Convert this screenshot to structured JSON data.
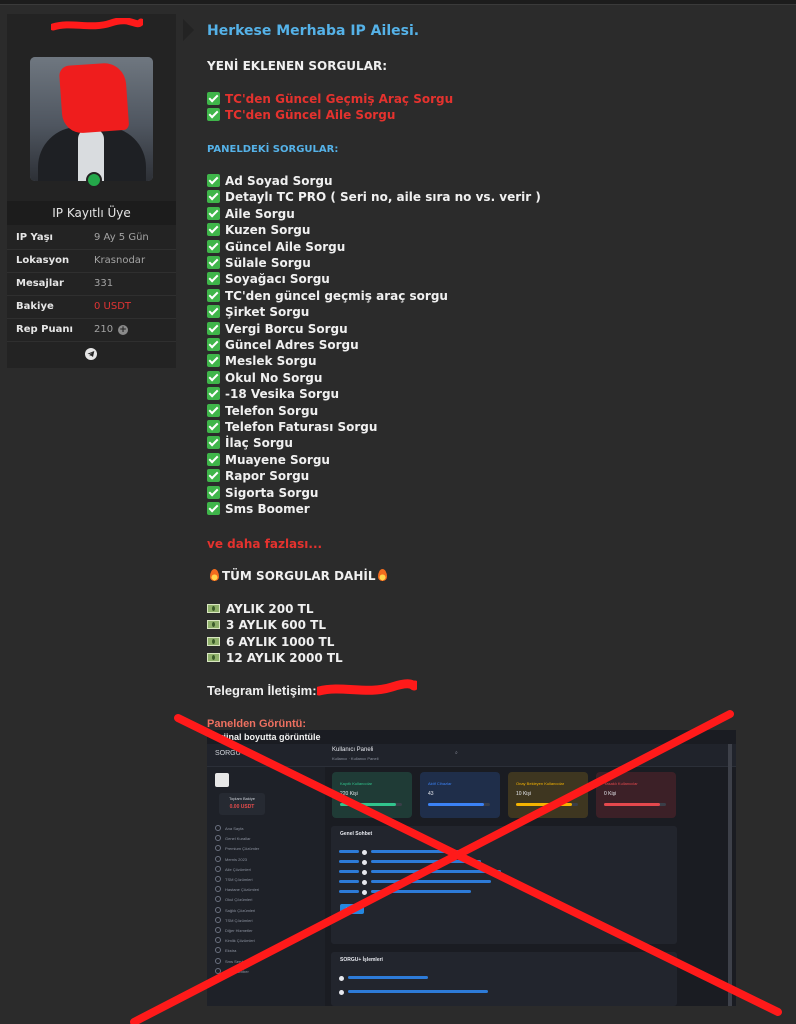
{
  "user": {
    "username": "",
    "rank": "IP Kayıtlı Üye",
    "stats": [
      {
        "label": "IP Yaşı",
        "value": "9 Ay 5 Gün",
        "highlight": false
      },
      {
        "label": "Lokasyon",
        "value": "Krasnodar",
        "highlight": false
      },
      {
        "label": "Mesajlar",
        "value": "331",
        "highlight": false
      },
      {
        "label": "Bakiye",
        "value": "0 USDT",
        "highlight": true
      },
      {
        "label": "Rep Puanı",
        "value": "210",
        "highlight": false
      }
    ],
    "online_color": "#24a84a"
  },
  "post": {
    "greeting": "Herkese Merhaba IP Ailesi.",
    "new_heading": "YENİ EKLENEN SORGULAR:",
    "new_items": [
      "TC'den Güncel Geçmiş Araç Sorgu",
      "TC'den Güncel Aile Sorgu"
    ],
    "panel_heading": "PANELDEKİ SORGULAR:",
    "panel_items": [
      "Ad Soyad Sorgu",
      "Detaylı TC PRO ( Seri no, aile sıra no vs. verir )",
      "Aile Sorgu",
      "Kuzen Sorgu",
      "Güncel Aile Sorgu",
      "Sülale Sorgu",
      "Soyağacı Sorgu",
      "TC'den güncel geçmiş araç sorgu",
      "Şirket Sorgu",
      "Vergi Borcu Sorgu",
      "Güncel Adres Sorgu",
      "Meslek Sorgu",
      "Okul No Sorgu",
      "-18 Vesika Sorgu",
      "Telefon Sorgu",
      "Telefon Faturası Sorgu",
      "İlaç Sorgu",
      "Muayene Sorgu",
      "Rapor Sorgu",
      "Sigorta Sorgu",
      "Sms Boomer"
    ],
    "more": "ve daha fazlası...",
    "all_included": "TÜM SORGULAR DAHİL",
    "prices": [
      "AYLIK 200 TL",
      "3 AYLIK 600 TL",
      "6 AYLIK 1000 TL",
      "12 AYLIK 2000 TL"
    ],
    "telegram": "Telegram İletişim:",
    "screenshot_label": "Panelden Görüntü:"
  },
  "screenshot": {
    "caption": "Orjinal boyutta görüntüle",
    "brand": "SORGU",
    "title": "Kullanıcı Paneli",
    "subtitle": "Kullanıcı  ·  Kullanıcı Paneli",
    "balance_label": "Toplam Bakiye",
    "balance_value": "0.00 USDT",
    "nav": [
      "Ana Sayfa",
      "Genel Kurallar",
      "Premium Çözümler",
      "Mernis 2023",
      "Aile Çözümleri",
      "TSM Çözümleri",
      "Hastane Çözümleri",
      "Okul Çözümleri",
      "Sağlık Çözümleri",
      "TSM Çözümleri",
      "Diğer Hizmetler",
      "Kimlik Çözümleri",
      "Ekstra",
      "Sms Servisi",
      "SMS Bomber"
    ],
    "cards": [
      {
        "title": "Kayıtlı Kullanıcılar",
        "value": "220 Kişi",
        "bg": "#1f3b36",
        "accent": "#31c48d",
        "level": 0.9
      },
      {
        "title": "Aktif Cihazlar",
        "value": "43",
        "bg": "#1f2e4a",
        "accent": "#3b82f6",
        "level": 0.9
      },
      {
        "title": "Onay Bekleyen Kullanıcılar",
        "value": "10 Kişi",
        "bg": "#3e3620",
        "accent": "#f5b301",
        "level": 0.9
      },
      {
        "title": "Yasaklı Kullanıcılar",
        "value": "0 Kişi",
        "bg": "#3c2027",
        "accent": "#e5484d",
        "level": 0.9
      }
    ],
    "chat_title": "Genel Sohbet",
    "chat_button": "Gönder",
    "log_title": "SORGU+ İşlemleri",
    "x_color": "#ff1a1a"
  }
}
